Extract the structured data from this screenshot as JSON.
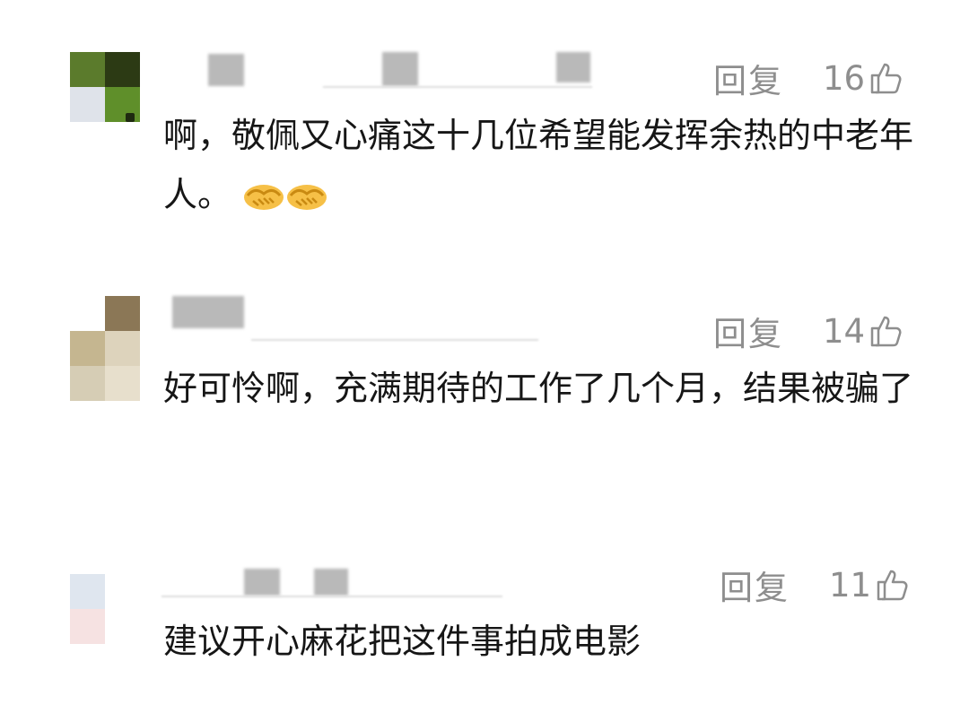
{
  "comments": [
    {
      "reply_label": "回复",
      "likes": "16",
      "text": "啊，敬佩又心痛这十几位希望能发挥余热的中老年人。",
      "emoji_icons": [
        "handshake-icon",
        "handshake-icon"
      ]
    },
    {
      "reply_label": "回复",
      "likes": "14",
      "text": "好可怜啊，充满期待的工作了几个月，结果被骗了"
    },
    {
      "reply_label": "回复",
      "likes": "11",
      "text": "建议开心麻花把这件事拍成电影"
    }
  ],
  "colors": {
    "meta_text": "#8e8e8e",
    "body_text": "#161616",
    "blur_gray": "#b9b9b9"
  },
  "icons": {
    "like": "thumbs-up-icon",
    "emoji": "handshake-icon"
  }
}
